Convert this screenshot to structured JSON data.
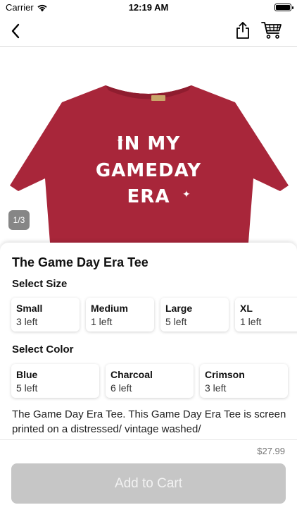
{
  "status_bar": {
    "carrier": "Carrier",
    "time": "12:19 AM",
    "battery_level": 0.9
  },
  "nav": {
    "back_icon": "chevron-left-icon",
    "share_icon": "share-icon",
    "cart_icon": "cart-icon"
  },
  "hero": {
    "shirt_color": "#a8263a",
    "print_lines": [
      "IN MY",
      "GAMEDAY",
      "ERA"
    ],
    "pager": "1/3"
  },
  "product": {
    "title": "The Game Day Era Tee",
    "size_label": "Select Size",
    "sizes": [
      {
        "name": "Small",
        "stock": "3 left"
      },
      {
        "name": "Medium",
        "stock": "1 left"
      },
      {
        "name": "Large",
        "stock": "5 left"
      },
      {
        "name": "XL",
        "stock": "1 left"
      }
    ],
    "color_label": "Select Color",
    "colors": [
      {
        "name": "Blue",
        "stock": "5 left"
      },
      {
        "name": "Charcoal",
        "stock": "6 left"
      },
      {
        "name": "Crimson",
        "stock": "3 left"
      }
    ],
    "description": "The Game Day Era Tee. This Game Day Era Tee is screen printed on a distressed/ vintage washed/"
  },
  "footer": {
    "price": "$27.99",
    "add_to_cart": "Add to Cart",
    "button_color": "#c6c6c6"
  }
}
